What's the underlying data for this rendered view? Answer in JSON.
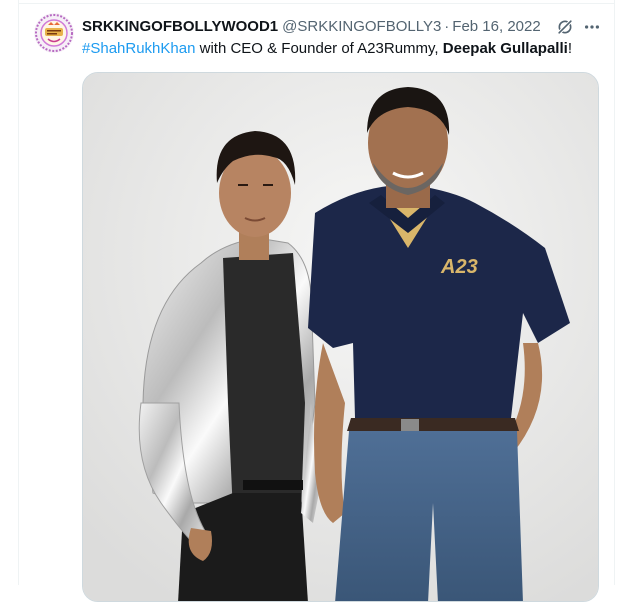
{
  "tweet": {
    "author": {
      "display_name": "SRKKINGOFBOLLYWOOD1",
      "handle": "@SRKKINGOFBOLLY3",
      "avatar_icon": "srk-fan-badge-avatar"
    },
    "separator": "·",
    "date": "Feb 16, 2022",
    "text": {
      "hashtag": "#ShahRukhKhan",
      "middle": " with CEO & Founder of A23Rummy, ",
      "bold_name": "Deepak Gullapalli",
      "end": "!"
    },
    "media": {
      "shirt_logo": "A23"
    }
  },
  "actions": {
    "grok_icon": "grok-icon",
    "more_icon": "more-horizontal-icon"
  },
  "colors": {
    "link": "#1d9bf0",
    "secondary_text": "#536471",
    "border": "#cfd9de",
    "logo_gold": "#d9b66a"
  }
}
